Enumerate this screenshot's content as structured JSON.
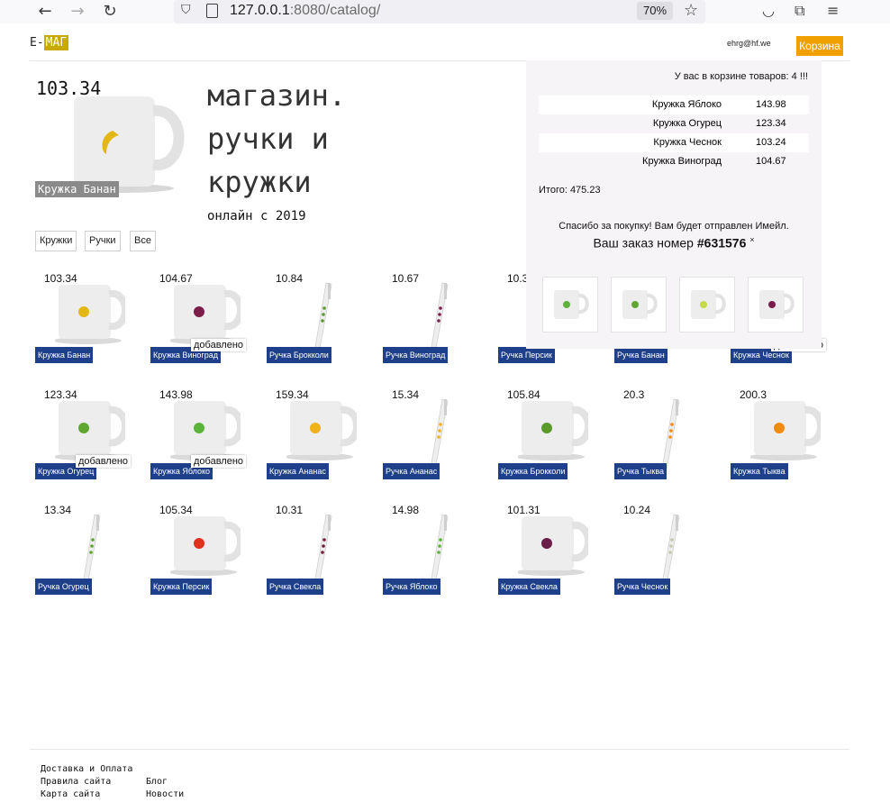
{
  "browser": {
    "url_host": "127.0.0.1",
    "url_rest": ":8080/catalog/",
    "zoom": "70%"
  },
  "header": {
    "logo_prefix": "E-",
    "logo_highlight": "МАГ",
    "email": "ehrg@hf.we",
    "cart_label": "Корзина"
  },
  "hero": {
    "price": "103.34",
    "label": "Кружка Банан",
    "title": "магазин.\nручки и\nкружки",
    "subtitle": "онлайн с 2019"
  },
  "filters": [
    "Кружки",
    "Ручки",
    "Все"
  ],
  "added_label": "добавлено",
  "products": [
    {
      "price": "103.34",
      "name": "Кружка Банан",
      "kind": "mug",
      "fruit_color": "#e3b715",
      "added": false
    },
    {
      "price": "104.67",
      "name": "Кружка Виноград",
      "kind": "mug",
      "fruit_color": "#7b1e4a",
      "added": true
    },
    {
      "price": "10.84",
      "name": "Ручка Брокколи",
      "kind": "pen",
      "fruit_color": "#5a9a2a",
      "added": false
    },
    {
      "price": "10.67",
      "name": "Ручка Виноград",
      "kind": "pen",
      "fruit_color": "#7b1e4a",
      "added": false
    },
    {
      "price": "10.3",
      "name": "Ручка Персик",
      "kind": "pen",
      "fruit_color": "#e0301e",
      "added": false
    },
    {
      "price": "",
      "name": "Ручка Банан",
      "kind": "pen",
      "fruit_color": "#e3b715",
      "added": false
    },
    {
      "price": "",
      "name": "Кружка Чеснок",
      "kind": "mug",
      "fruit_color": "#c7c7b0",
      "added": true
    },
    {
      "price": "123.34",
      "name": "Кружка Огурец",
      "kind": "mug",
      "fruit_color": "#62a632",
      "added": true
    },
    {
      "price": "143.98",
      "name": "Кружка Яблоко",
      "kind": "mug",
      "fruit_color": "#5bb33a",
      "added": true
    },
    {
      "price": "159.34",
      "name": "Кружка Ананас",
      "kind": "mug",
      "fruit_color": "#f0b21a",
      "added": false
    },
    {
      "price": "15.34",
      "name": "Ручка Ананас",
      "kind": "pen",
      "fruit_color": "#f0b21a",
      "added": false
    },
    {
      "price": "105.84",
      "name": "Кружка Брокколи",
      "kind": "mug",
      "fruit_color": "#5a9a2a",
      "added": false
    },
    {
      "price": "20.3",
      "name": "Ручка Тыква",
      "kind": "pen",
      "fruit_color": "#f08a10",
      "added": false
    },
    {
      "price": "200.3",
      "name": "Кружка Тыква",
      "kind": "mug",
      "fruit_color": "#f08a10",
      "added": false
    },
    {
      "price": "13.34",
      "name": "Ручка Огурец",
      "kind": "pen",
      "fruit_color": "#62a632",
      "added": false
    },
    {
      "price": "105.34",
      "name": "Кружка Персик",
      "kind": "mug",
      "fruit_color": "#e0301e",
      "added": false
    },
    {
      "price": "10.31",
      "name": "Ручка Свекла",
      "kind": "pen",
      "fruit_color": "#7b1e3a",
      "added": false
    },
    {
      "price": "14.98",
      "name": "Ручка Яблоко",
      "kind": "pen",
      "fruit_color": "#5bb33a",
      "added": false
    },
    {
      "price": "101.31",
      "name": "Кружка Свекла",
      "kind": "mug",
      "fruit_color": "#6b1e4a",
      "added": false
    },
    {
      "price": "10.24",
      "name": "Ручка Чеснок",
      "kind": "pen",
      "fruit_color": "#c7c7b0",
      "added": false
    }
  ],
  "cart": {
    "count_text": "У вас в корзине товаров: 4 !!!",
    "items": [
      {
        "name": "Кружка Яблоко",
        "price": "143.98"
      },
      {
        "name": "Кружка Огурец",
        "price": "123.34"
      },
      {
        "name": "Кружка Чеснок",
        "price": "103.24"
      },
      {
        "name": "Кружка Виноград",
        "price": "104.67"
      }
    ],
    "total": "Итого: 475.23",
    "thanks": "Спасибо за покупку! Вам будет отправлен Имейл.",
    "order_prefix": "Ваш заказ номер ",
    "order_number": "#631576",
    "close_glyph": "×",
    "thumb_colors": [
      "#5bb33a",
      "#62a632",
      "#c5d94a",
      "#7b1e4a"
    ]
  },
  "footer": {
    "links": [
      "Доставка и Оплата",
      "Правила сайта",
      "Карта сайта",
      "Блог",
      "Новости"
    ]
  }
}
